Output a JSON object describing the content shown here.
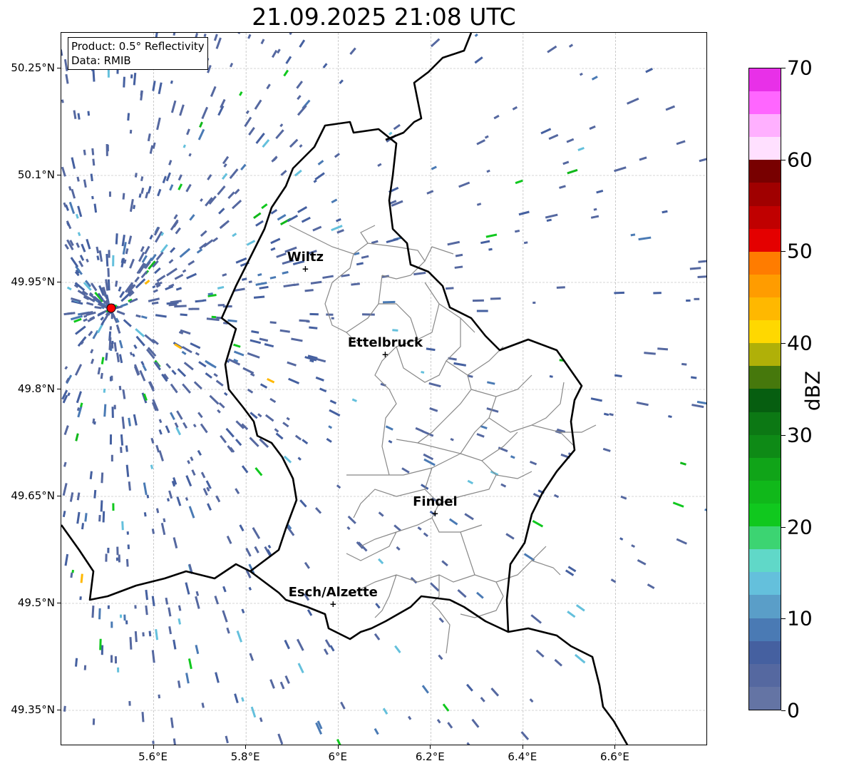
{
  "title": "21.09.2025 21:08 UTC",
  "legend": {
    "product": "Product: 0.5° Reflectivity",
    "data": "Data: RMIB"
  },
  "x_ticks": [
    {
      "lon": 5.6,
      "label": "5.6°E"
    },
    {
      "lon": 5.8,
      "label": "5.8°E"
    },
    {
      "lon": 6.0,
      "label": "6°E"
    },
    {
      "lon": 6.2,
      "label": "6.2°E"
    },
    {
      "lon": 6.4,
      "label": "6.4°E"
    },
    {
      "lon": 6.6,
      "label": "6.6°E"
    }
  ],
  "y_ticks": [
    {
      "lat": 50.25,
      "label": "50.25°N"
    },
    {
      "lat": 50.1,
      "label": "50.1°N"
    },
    {
      "lat": 49.95,
      "label": "49.95°N"
    },
    {
      "lat": 49.8,
      "label": "49.8°N"
    },
    {
      "lat": 49.65,
      "label": "49.65°N"
    },
    {
      "lat": 49.5,
      "label": "49.5°N"
    },
    {
      "lat": 49.35,
      "label": "49.35°N"
    }
  ],
  "extent": {
    "lon": [
      5.4,
      6.8
    ],
    "lat": [
      49.3,
      50.3
    ]
  },
  "radar_site": {
    "lon": 5.508,
    "lat": 49.914,
    "color": "#ff0000"
  },
  "cities": [
    {
      "name": "Wiltz",
      "lon": 5.93,
      "lat": 49.968
    },
    {
      "name": "Ettelbruck",
      "lon": 6.103,
      "lat": 49.848
    },
    {
      "name": "Findel",
      "lon": 6.211,
      "lat": 49.625
    },
    {
      "name": "Esch/Alzette",
      "lon": 5.99,
      "lat": 49.498
    }
  ],
  "colorbar": {
    "label": "dBZ",
    "ticks": [
      "0",
      "10",
      "20",
      "30",
      "40",
      "50",
      "60",
      "70"
    ],
    "range": [
      0,
      70
    ],
    "colors": [
      "#6474a4",
      "#5568a0",
      "#4560a0",
      "#4a7ab4",
      "#5a9ec8",
      "#64c0dc",
      "#60d8c8",
      "#3cd472",
      "#10c81e",
      "#10b81a",
      "#10a418",
      "#0e8a16",
      "#0c7814",
      "#065e10",
      "#46780c",
      "#b0b008",
      "#ffd800",
      "#ffb800",
      "#ff9c00",
      "#ff7c00",
      "#e40000",
      "#c00000",
      "#a00000",
      "#780000",
      "#ffe0ff",
      "#ffb0ff",
      "#ff66ff",
      "#e830e8"
    ]
  }
}
